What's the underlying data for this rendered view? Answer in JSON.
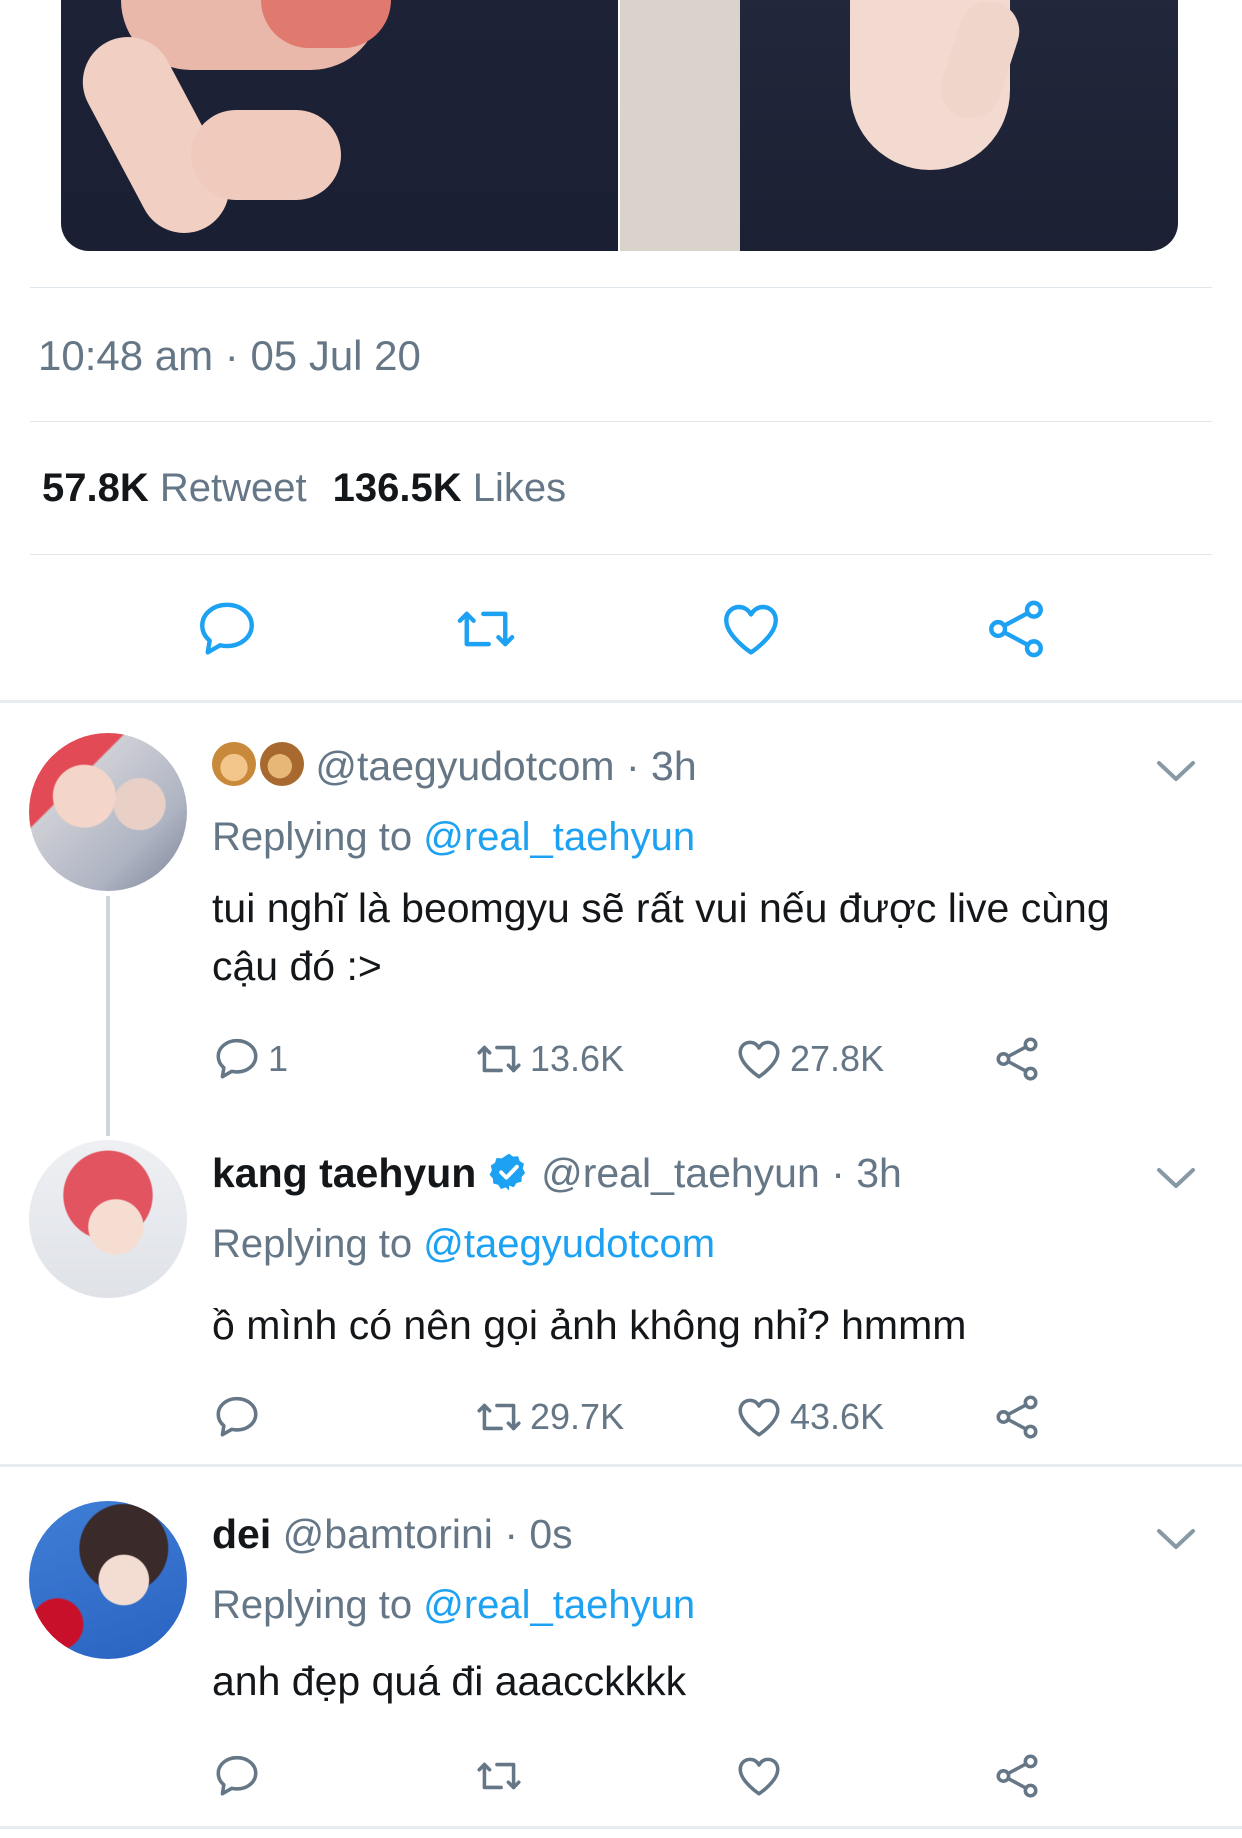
{
  "tweet": {
    "timestamp": "10:48 am · 05 Jul 20",
    "retweet_count": "57.8K",
    "retweet_label": "Retweet",
    "likes_count": "136.5K",
    "likes_label": "Likes"
  },
  "replies": [
    {
      "display_name": "",
      "handle": "@taegyudotcom",
      "time": "· 3h",
      "replying_label": "Replying to",
      "replying_to": "@real_taehyun",
      "text_line1": "tui nghĩ là beomgyu sẽ rất vui nếu được live cùng",
      "text_line2": "cậu đó :>",
      "reply_count": "1",
      "retweet_count": "13.6K",
      "like_count": "27.8K"
    },
    {
      "display_name": "kang taehyun",
      "verified": true,
      "handle": "@real_taehyun",
      "time": "· 3h",
      "replying_label": "Replying to",
      "replying_to": "@taegyudotcom",
      "text": "ồ mình có nên gọi ảnh không nhỉ? hmmm",
      "reply_count": "",
      "retweet_count": "29.7K",
      "like_count": "43.6K"
    },
    {
      "display_name": "dei",
      "handle": "@bamtorini",
      "time": "· 0s",
      "replying_label": "Replying to",
      "replying_to": "@real_taehyun",
      "text": "anh đẹp quá đi aaacckkkk",
      "reply_count": "",
      "retweet_count": "",
      "like_count": ""
    }
  ],
  "colors": {
    "accent": "#1da1f2",
    "muted": "#657786",
    "text": "#14171a",
    "divider": "#e1e8ed"
  }
}
